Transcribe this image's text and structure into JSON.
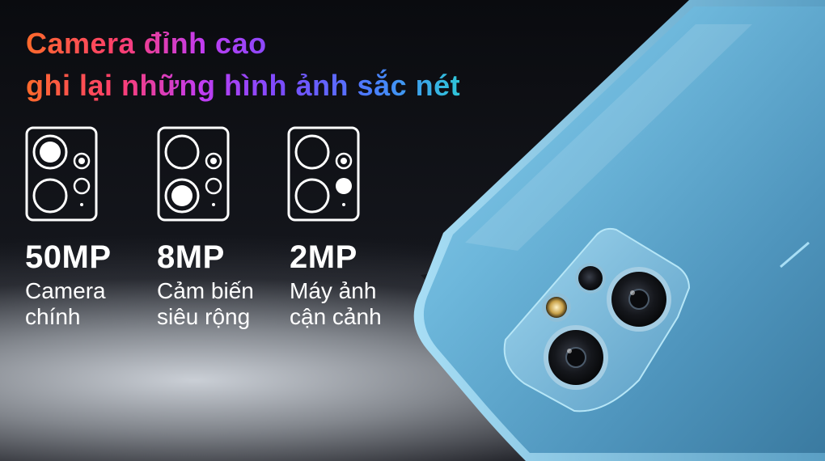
{
  "headline": {
    "line1": "Camera đỉnh cao",
    "line2": "ghi lại những hình ảnh sắc nét"
  },
  "cameras": [
    {
      "mp": "50MP",
      "description": "Camera\nchính",
      "icon": "main-camera-lens-icon"
    },
    {
      "mp": "8MP",
      "description": "Cảm biến\nsiêu rộng",
      "icon": "ultra-wide-lens-icon"
    },
    {
      "mp": "2MP",
      "description": "Máy ảnh\ncận cảnh",
      "icon": "macro-lens-icon"
    }
  ],
  "colors": {
    "gradient": [
      "#ff6a2b",
      "#ff3f6a",
      "#c33cf0",
      "#7a4cff",
      "#4a7dff",
      "#2fc6d8",
      "#3fe0b0"
    ],
    "phone_body": "#6fb8dc",
    "text": "#ffffff"
  }
}
